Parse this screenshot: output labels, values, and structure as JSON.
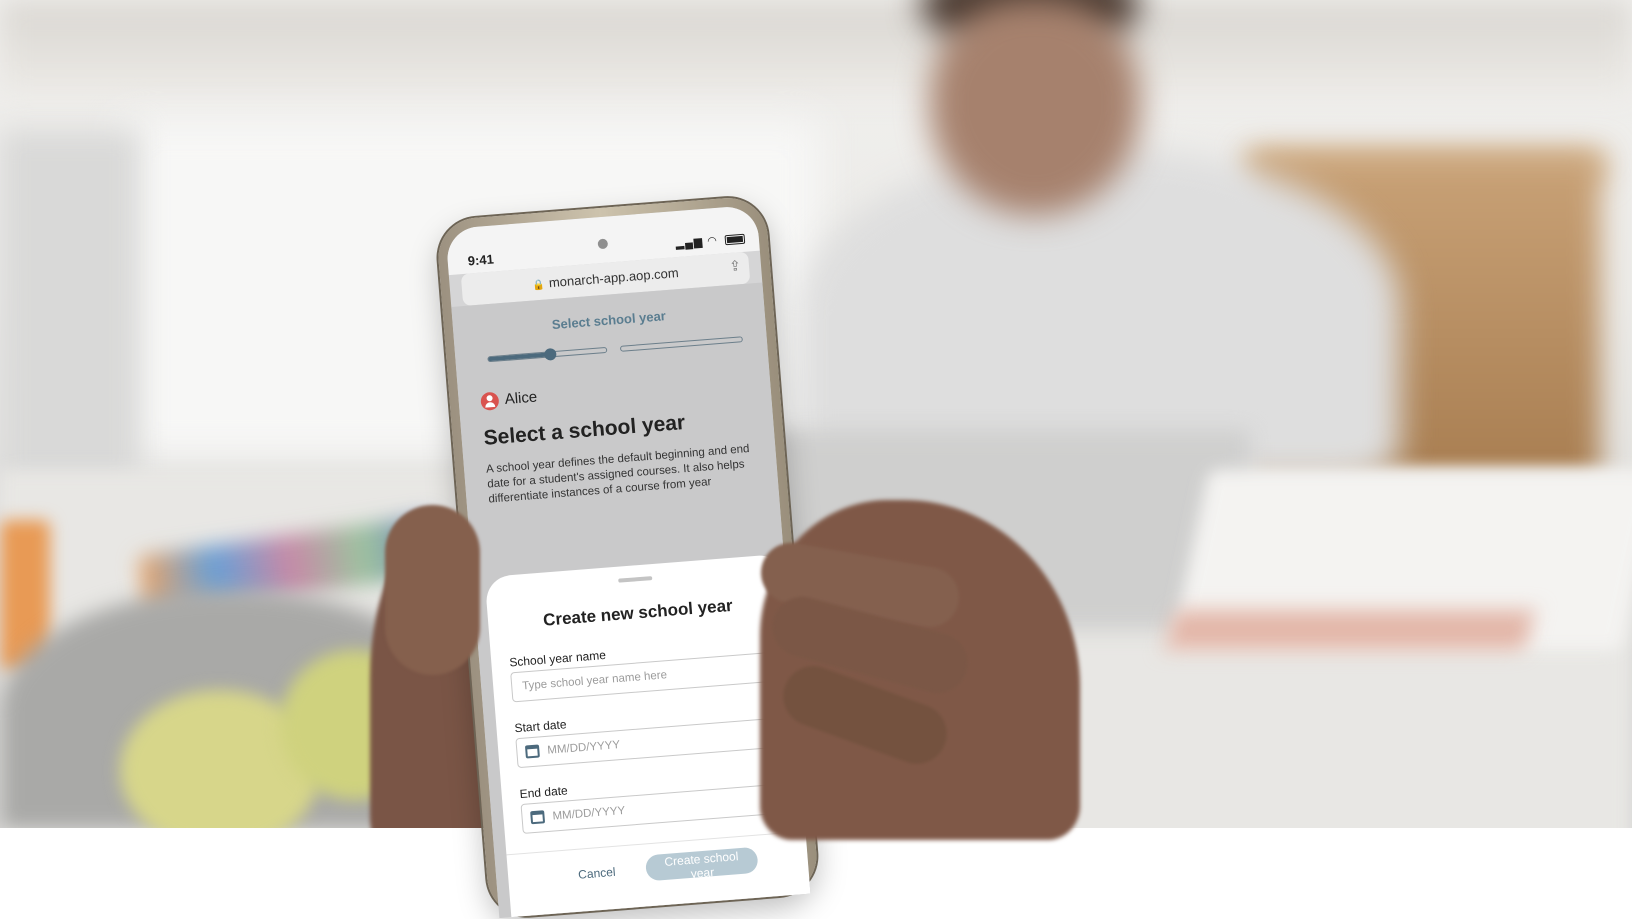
{
  "status_bar": {
    "time": "9:41",
    "signal": "▂▄▆",
    "wifi": "◠"
  },
  "browser": {
    "url": "monarch-app.aop.com",
    "lock": "🔒",
    "share": "⇪"
  },
  "page": {
    "title": "Select school year",
    "progress": {
      "steps": 2,
      "current_step": 1,
      "current_step_fraction": 0.52
    },
    "student_name": "Alice",
    "heading": "Select a school year",
    "description": "A school year defines the default beginning and end date for a student's assigned courses. It also helps differentiate instances of a course from year"
  },
  "sheet": {
    "title": "Create new school year",
    "name_label": "School year name",
    "name_placeholder": "Type school year name here",
    "start_label": "Start date",
    "start_placeholder": "MM/DD/YYYY",
    "end_label": "End date",
    "end_placeholder": "MM/DD/YYYY",
    "cancel_label": "Cancel",
    "create_label": "Create school year"
  },
  "colors": {
    "accent": "#4c6a7d",
    "title_teal": "#5a7d90",
    "create_button": "#b7cad4",
    "avatar": "#d9534f"
  }
}
